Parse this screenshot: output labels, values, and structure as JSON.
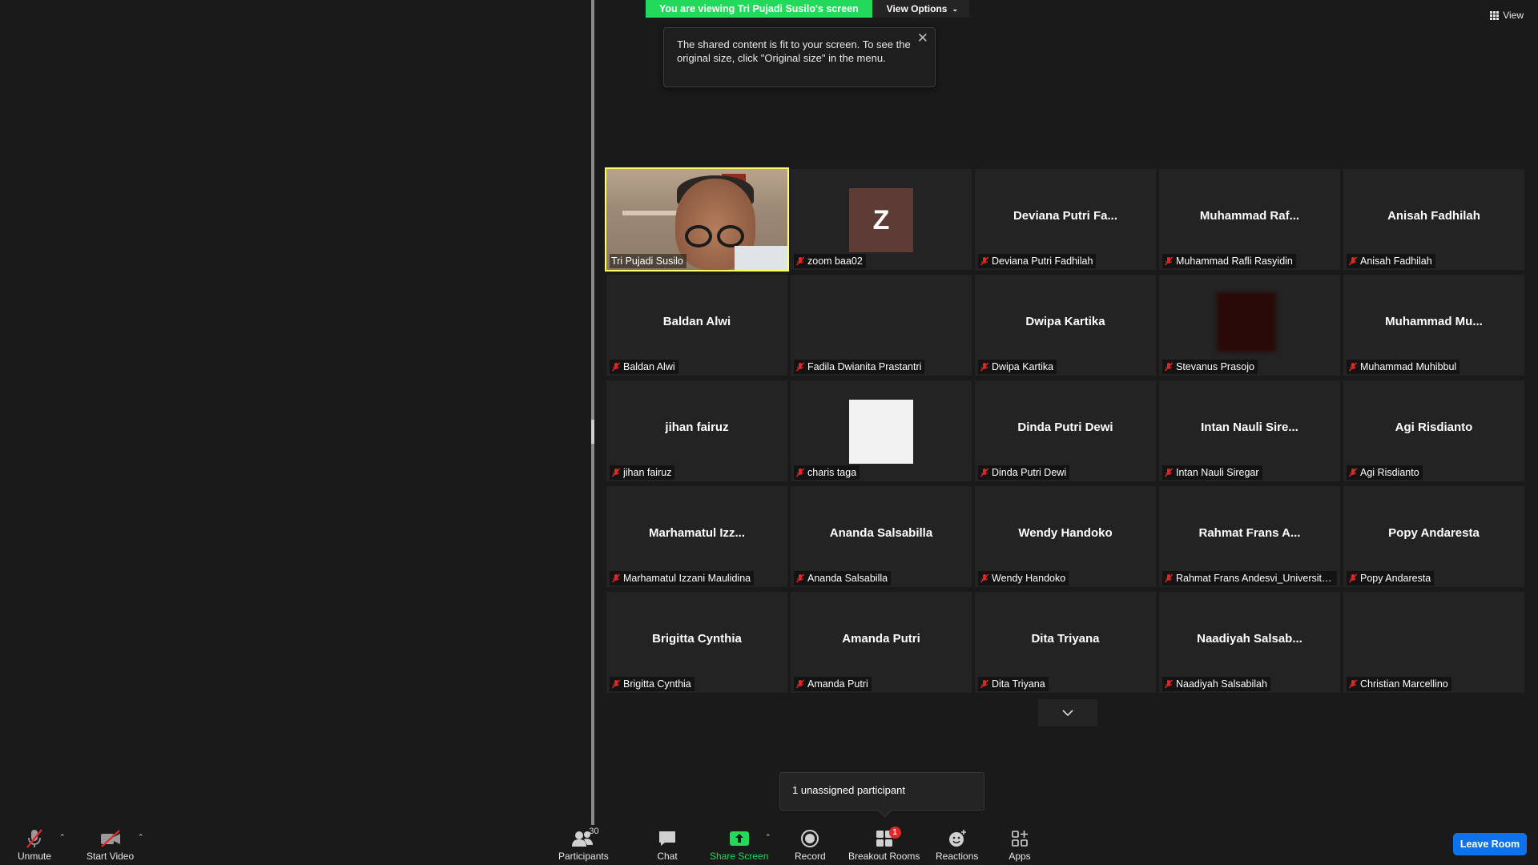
{
  "banner": {
    "sharing_text": "You are viewing Tri Pujadi Susilo's screen",
    "view_options": "View Options"
  },
  "tooltip": {
    "text": "The shared content is fit to your screen. To see the original size, click \"Original size\" in the menu."
  },
  "view_button": "View",
  "tiles": [
    {
      "big": "",
      "label": "Tri Pujadi Susilo",
      "type": "video"
    },
    {
      "big": "",
      "label": "zoom baa02",
      "type": "avatar-z",
      "avatar_letter": "Z"
    },
    {
      "big": "Deviana Putri Fa...",
      "label": "Deviana Putri Fadhilah",
      "type": "name"
    },
    {
      "big": "Muhammad  Raf...",
      "label": "Muhammad Rafli Rasyidin",
      "type": "name"
    },
    {
      "big": "Anisah Fadhilah",
      "label": "Anisah Fadhilah",
      "type": "name"
    },
    {
      "big": "Baldan Alwi",
      "label": "Baldan Alwi",
      "type": "name"
    },
    {
      "big": "",
      "label": "Fadila Dwianita Prastantri",
      "type": "blank"
    },
    {
      "big": "Dwipa Kartika",
      "label": "Dwipa Kartika",
      "type": "name"
    },
    {
      "big": "",
      "label": "Stevanus Prasojo",
      "type": "avatar-dark"
    },
    {
      "big": "Muhammad  Mu...",
      "label": "Muhammad Muhibbul",
      "type": "name"
    },
    {
      "big": "jihan fairuz",
      "label": "jihan fairuz",
      "type": "name"
    },
    {
      "big": "",
      "label": "charis taga",
      "type": "avatar-white"
    },
    {
      "big": "Dinda Putri Dewi",
      "label": "Dinda Putri Dewi",
      "type": "name"
    },
    {
      "big": "Intan  Nauli  Sire...",
      "label": "Intan Nauli Siregar",
      "type": "name"
    },
    {
      "big": "Agi Risdianto",
      "label": "Agi Risdianto",
      "type": "name"
    },
    {
      "big": "Marhamatul  Izz...",
      "label": "Marhamatul Izzani Maulidina",
      "type": "name"
    },
    {
      "big": "Ananda Salsabilla",
      "label": "Ananda Salsabilla",
      "type": "name"
    },
    {
      "big": "Wendy Handoko",
      "label": "Wendy Handoko",
      "type": "name"
    },
    {
      "big": "Rahmat Frans A...",
      "label": "Rahmat Frans Andesvi_Universita...",
      "type": "name"
    },
    {
      "big": "Popy Andaresta",
      "label": "Popy Andaresta",
      "type": "name"
    },
    {
      "big": "Brigitta Cynthia",
      "label": "Brigitta Cynthia",
      "type": "name"
    },
    {
      "big": "Amanda Putri",
      "label": "Amanda Putri",
      "type": "name"
    },
    {
      "big": "Dita Triyana",
      "label": "Dita Triyana",
      "type": "name"
    },
    {
      "big": "Naadiyah  Salsab...",
      "label": "Naadiyah Salsabilah",
      "type": "name"
    },
    {
      "big": "",
      "label": "Christian Marcellino",
      "type": "blank"
    }
  ],
  "notice": "1 unassigned participant",
  "toolbar": {
    "unmute": "Unmute",
    "start_video": "Start Video",
    "participants": "Participants",
    "participants_count": "30",
    "chat": "Chat",
    "share_screen": "Share Screen",
    "record": "Record",
    "breakout_rooms": "Breakout Rooms",
    "breakout_badge": "1",
    "reactions": "Reactions",
    "apps": "Apps",
    "leave_room": "Leave Room"
  },
  "colors": {
    "share_green": "#23d959",
    "leave_blue": "#0e72ed",
    "active_speaker": "#ffff60",
    "mute_red": "#e02828"
  }
}
